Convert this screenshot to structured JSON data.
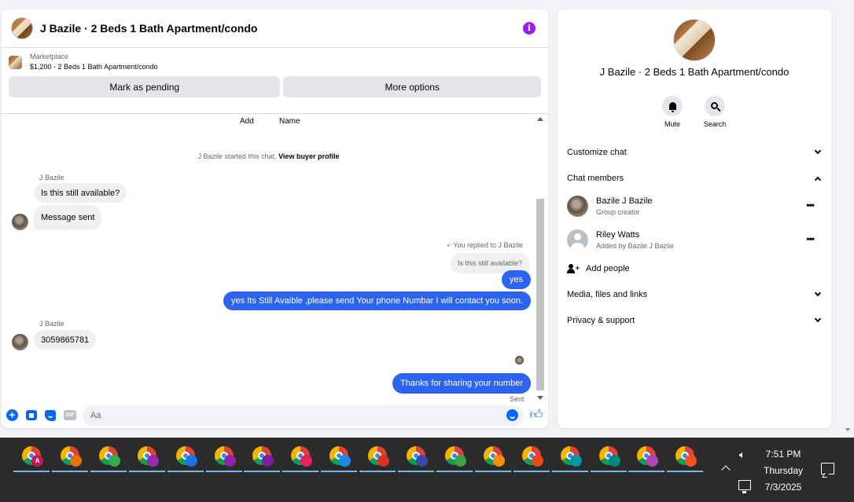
{
  "chat": {
    "title": "J Bazile · 2 Beds 1 Bath Apartment/condo",
    "info_icon": "i",
    "marketplace_label": "Marketplace",
    "listing": "$1,200 - 2 Beds 1 Bath Apartment/condo",
    "mark_pending": "Mark as pending",
    "more_options": "More options",
    "col_add": "Add",
    "col_name": "Name",
    "system_prefix": "J Bazile started this chat.",
    "system_link": "View buyer profile",
    "sender1": "J Bazile",
    "msg_in1": "Is this still available?",
    "msg_in2": "Message sent",
    "replied_note": "You replied to J Bazile",
    "quoted": "Is this still available?",
    "msg_out1": "yes",
    "msg_out2": "yes Its Still Avaible ,please send Your phone Numbar I will contact you soon.",
    "sender2": "J Bazile",
    "msg_in3": "3059865781",
    "msg_out3": "Thanks for sharing your number",
    "sent_status": "Sent",
    "input_placeholder": "Aa",
    "gif_label": "GIF",
    "accent_color": "#2d64ef"
  },
  "info": {
    "title": "J Bazile · 2 Beds 1 Bath Apartment/condo",
    "mute": "Mute",
    "search": "Search",
    "customize": "Customize chat",
    "members_header": "Chat members",
    "members": [
      {
        "name": "Bazile J Bazile",
        "sub": "Group creator"
      },
      {
        "name": "Riley Watts",
        "sub": "Added by Bazile J Bazile"
      }
    ],
    "more_dots": "•••",
    "add_people": "Add people",
    "media": "Media, files and links",
    "privacy": "Privacy & support"
  },
  "taskbar": {
    "time": "7:51 PM",
    "day": "Thursday",
    "date": "7/3/2025",
    "first_badge": "A",
    "badge_colors": [
      "#c2185b",
      "#e8710a",
      "#34a853",
      "#9c27b0",
      "#1a73e8",
      "#8e24aa",
      "#7b1fa2",
      "#e91e63",
      "#1e88e5",
      "#d93025",
      "#3949ab",
      "#43a047",
      "#fb8c00",
      "#e64a19",
      "#0097a7",
      "#00897b",
      "#ab47bc",
      "#f4511e"
    ]
  }
}
